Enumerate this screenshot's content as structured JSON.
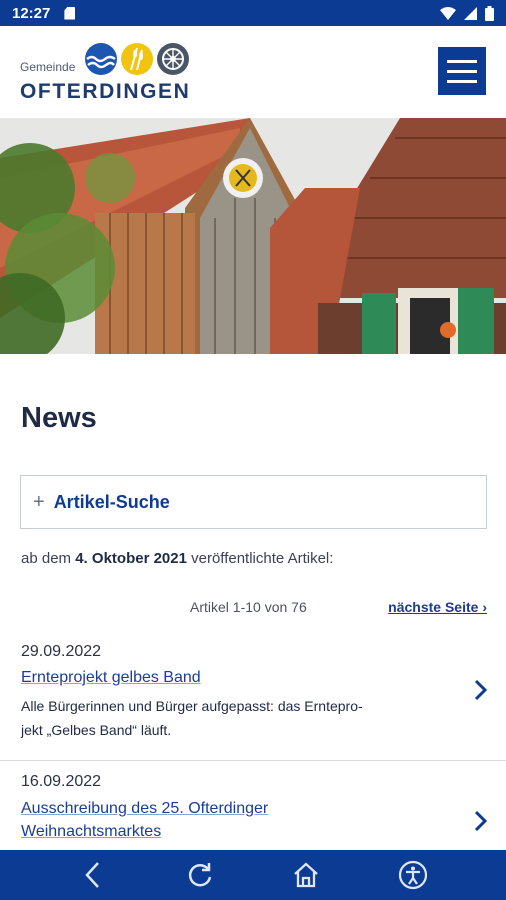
{
  "status_bar": {
    "time": "12:27",
    "icons": [
      "sd-card-icon",
      "wifi-icon",
      "signal-icon",
      "battery-icon"
    ]
  },
  "header": {
    "logo_small": "Gemeinde",
    "logo_name": "OFTERDINGEN",
    "menu_icon": "hamburger-menu-icon"
  },
  "page": {
    "title": "News",
    "search_toggle_symbol": "+",
    "search_label": "Artikel-Suche",
    "since_prefix": "ab dem",
    "since_date": "4. Oktober 2021",
    "since_suffix": "veröffentlichte Artikel:",
    "pager_count": "Artikel 1-10 von 76",
    "pager_next": "nächste Seite ›"
  },
  "articles": [
    {
      "date": "29.09.2022",
      "title": "Ernteprojekt gelbes Band",
      "teaser_line1": "Alle Bürgerinnen und Bürger aufgepasst: das Erntepro-",
      "teaser_line2": "jekt „Gelbes Band“ läuft."
    },
    {
      "date": "16.09.2022",
      "title_line1": "Ausschreibung des 25. Ofterdinger",
      "title_line2": "Weihnachtsmarktes"
    }
  ],
  "bottom_nav": [
    "back-icon",
    "reload-icon",
    "home-icon",
    "accessibility-icon"
  ],
  "colors": {
    "brand_blue": "#0c3b94",
    "link_blue": "#1a3d97",
    "text_dark": "#1f2a44",
    "border_gray": "#c7ccd3"
  }
}
